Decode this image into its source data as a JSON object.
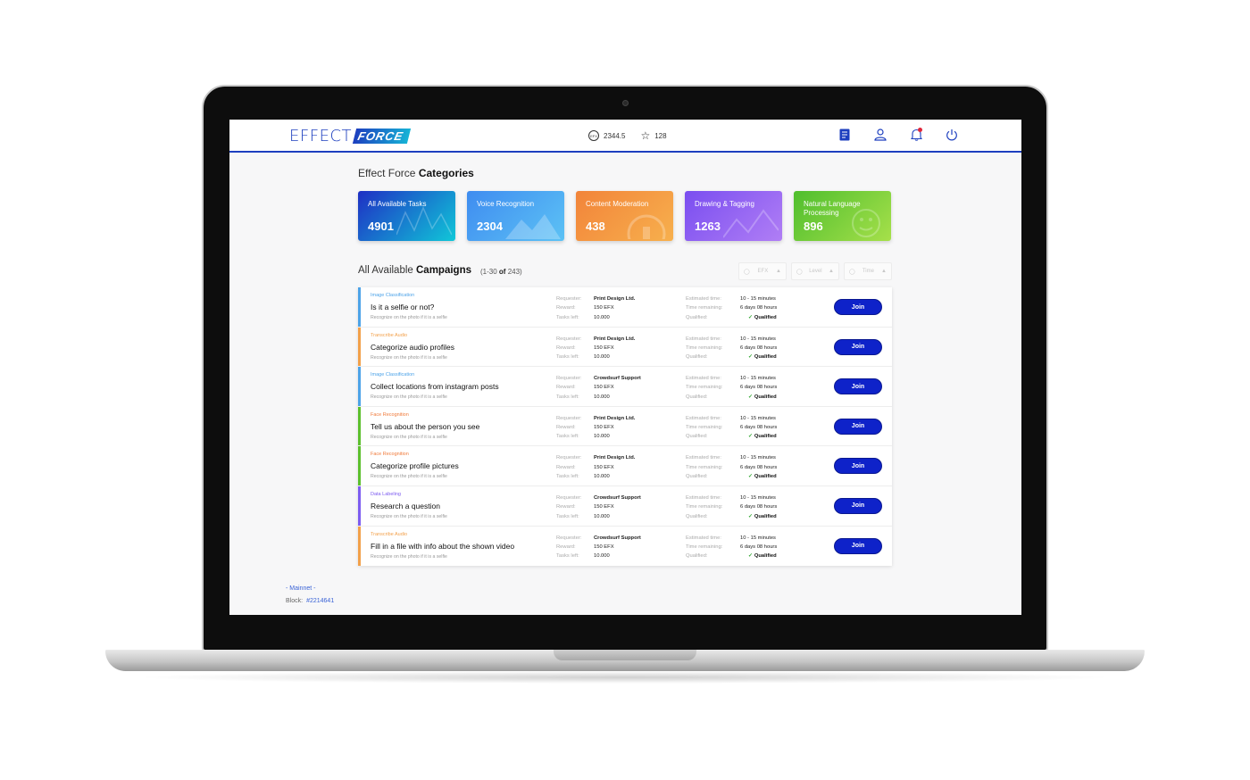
{
  "header": {
    "logo_effect": "EFFECT",
    "logo_force": "FORCE",
    "efx_coin_label": "EFX",
    "efx_balance": "2344.5",
    "reputation": "128",
    "icons": [
      "tasks-icon",
      "user-icon",
      "bell-icon",
      "power-icon"
    ]
  },
  "categories": {
    "title_prefix": "Effect Force ",
    "title_bold": "Categories",
    "items": [
      {
        "label": "All Available Tasks",
        "count": "4901",
        "color_from": "#1f2fc4",
        "color_to": "#10c7d8"
      },
      {
        "label": "Voice Recognition",
        "count": "2304",
        "color_from": "#3f8cf0",
        "color_to": "#5cc2f5"
      },
      {
        "label": "Content Moderation",
        "count": "438",
        "color_from": "#f2843a",
        "color_to": "#f7b04d"
      },
      {
        "label": "Drawing & Tagging",
        "count": "1263",
        "color_from": "#7a4ef0",
        "color_to": "#b07ef5"
      },
      {
        "label": "Natural Language Processing",
        "count": "896",
        "color_from": "#4fbe2e",
        "color_to": "#a6e04a"
      }
    ]
  },
  "campaigns": {
    "title_prefix": "All Available ",
    "title_bold": "Campaigns",
    "count_open": "(1-30 ",
    "count_of": "of",
    "count_close": " 243)",
    "sorters": [
      "EFX",
      "Level",
      "Time"
    ],
    "labels": {
      "requester": "Requester:",
      "reward": "Reward:",
      "tasks_left": "Tasks left:",
      "estimated_time": "Estimated time:",
      "time_remaining": "Time remaining:",
      "qualified": "Qualified:",
      "qualified_value": "Qualified",
      "join": "Join"
    },
    "rows": [
      {
        "category": "Image Classification",
        "cat_color": "#4da3e8",
        "title": "Is it a selfie or not?",
        "description": "Recognize on the photo if it is a selfie",
        "requester": "Print Design Ltd.",
        "reward": "150 EFX",
        "tasks_left": "10.000",
        "estimated_time": "10 - 15 minutes",
        "time_remaining": "6 days 08 hours"
      },
      {
        "category": "Transcribe Audio",
        "cat_color": "#f2a04a",
        "title": "Categorize audio profiles",
        "description": "Recognize on the photo if it is a selfie",
        "requester": "Print Design Ltd.",
        "reward": "150 EFX",
        "tasks_left": "10.000",
        "estimated_time": "10 - 15 minutes",
        "time_remaining": "6 days 08 hours"
      },
      {
        "category": "Image Classification",
        "cat_color": "#4da3e8",
        "title": "Collect locations from instagram posts",
        "description": "Recognize on the photo if it is a selfie",
        "requester": "Crowdsurf Support",
        "reward": "150 EFX",
        "tasks_left": "10.000",
        "estimated_time": "10 - 15 minutes",
        "time_remaining": "6 days 08 hours"
      },
      {
        "category": "Face Recognition",
        "cat_color": "#f07a3a",
        "bar_color": "#5cc02e",
        "title": "Tell us about the person you see",
        "description": "Recognize on the photo if it is a selfie",
        "requester": "Print Design Ltd.",
        "reward": "150 EFX",
        "tasks_left": "10.000",
        "estimated_time": "10 - 15 minutes",
        "time_remaining": "6 days 08 hours"
      },
      {
        "category": "Face Recognition",
        "cat_color": "#f07a3a",
        "bar_color": "#5cc02e",
        "title": "Categorize profile pictures",
        "description": "Recognize on the photo if it is a selfie",
        "requester": "Print Design Ltd.",
        "reward": "150 EFX",
        "tasks_left": "10.000",
        "estimated_time": "10 - 15 minutes",
        "time_remaining": "6 days 08 hours"
      },
      {
        "category": "Data Labeling",
        "cat_color": "#7d5cf0",
        "title": "Research a question",
        "description": "Recognize on the photo if it is a selfie",
        "requester": "Crowdsurf Support",
        "reward": "150 EFX",
        "tasks_left": "10.000",
        "estimated_time": "10 - 15 minutes",
        "time_remaining": "6 days 08 hours"
      },
      {
        "category": "Transcribe Audio",
        "cat_color": "#f2a04a",
        "title": "Fill in a file with info about the shown video",
        "description": "Recognize on the photo if it is a selfie",
        "requester": "Crowdsurf Support",
        "reward": "150 EFX",
        "tasks_left": "10.000",
        "estimated_time": "10 - 15 minutes",
        "time_remaining": "6 days 08 hours"
      }
    ]
  },
  "footer": {
    "network": "- Mainnet -",
    "block_label": "Block:",
    "block_number": "#2214641"
  }
}
